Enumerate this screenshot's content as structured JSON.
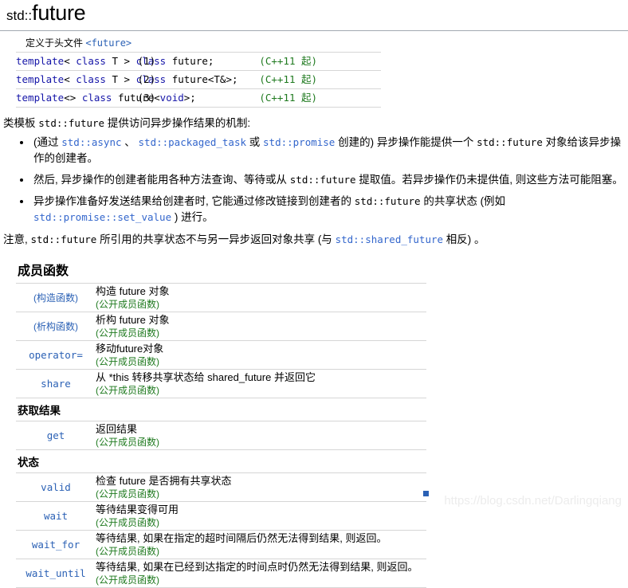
{
  "page": {
    "title_namespace": "std::",
    "title_name": "future"
  },
  "declaration_table": {
    "header_text": "定义于头文件 ",
    "header_code": "<future>",
    "rows": [
      {
        "code_parts": [
          {
            "t": "template",
            "c": "kw"
          },
          {
            "t": "< ",
            "c": "plain"
          },
          {
            "t": "class",
            "c": "kw"
          },
          {
            "t": " T > ",
            "c": "plain"
          },
          {
            "t": "class",
            "c": "kw"
          },
          {
            "t": " future;",
            "c": "plain"
          }
        ],
        "plain_code": "template< class T > class future;",
        "number": "(1)",
        "since": "(C++11 起)"
      },
      {
        "code_parts": [
          {
            "t": "template",
            "c": "kw"
          },
          {
            "t": "< ",
            "c": "plain"
          },
          {
            "t": "class",
            "c": "kw"
          },
          {
            "t": " T > ",
            "c": "plain"
          },
          {
            "t": "class",
            "c": "kw"
          },
          {
            "t": " future<T&>;",
            "c": "plain"
          }
        ],
        "plain_code": "template< class T > class future<T&>;",
        "number": "(2)",
        "since": "(C++11 起)"
      },
      {
        "code_parts": [
          {
            "t": "template",
            "c": "kw"
          },
          {
            "t": "<>",
            "c": "plain"
          },
          {
            "t": "            ",
            "c": "plain"
          },
          {
            "t": "class",
            "c": "kw"
          },
          {
            "t": " future<",
            "c": "plain"
          },
          {
            "t": "void",
            "c": "kw"
          },
          {
            "t": ">;",
            "c": "plain"
          }
        ],
        "plain_code": "template<>             class future<void>;",
        "number": "(3)",
        "since": "(C++11 起)"
      }
    ]
  },
  "description": {
    "intro_a": "类模板 ",
    "intro_code": "std::future",
    "intro_b": " 提供访问异步操作结果的机制:",
    "bullets": [
      {
        "p1": "(通过 ",
        "l1": "std::async",
        "p2": " 、 ",
        "l2": "std::packaged_task",
        "p3": " 或 ",
        "l3": "std::promise",
        "p4": " 创建的) 异步操作能提供一个 ",
        "c1": "std::future",
        "p5": " 对象给该异步操作的创建者。"
      },
      {
        "p1": "然后, 异步操作的创建者能用各种方法查询、等待或从 ",
        "c1": "std::future",
        "p5": " 提取值。若异步操作仍未提供值, 则这些方法可能阻塞。"
      },
      {
        "p1": "异步操作准备好发送结果给创建者时, 它能通过修改链接到创建者的 ",
        "c1": "std::future",
        "p5": " 的共享状态 (例如 ",
        "l1": "std::promise::set_value",
        "p6": " ) 进行。"
      }
    ],
    "note_a": "注意, ",
    "note_code": "std::future",
    "note_b": " 所引用的共享状态不与另一异步返回对象共享 (与 ",
    "note_link": "std::shared_future",
    "note_c": " 相反) 。"
  },
  "members": {
    "heading": "成员函数",
    "rows": [
      {
        "name": "(构造函数)",
        "name_is_cn": true,
        "desc": "构造 future 对象",
        "desc_code": "future",
        "kind": "(公开成员函数)"
      },
      {
        "name": "(析构函数)",
        "name_is_cn": true,
        "desc": "析构 future 对象",
        "desc_code": "future",
        "kind": "(公开成员函数)"
      },
      {
        "name": "operator=",
        "name_is_cn": false,
        "desc": "移动future对象",
        "kind": "(公开成员函数)"
      },
      {
        "name": "share",
        "name_is_cn": false,
        "desc": "从 *this 转移共享状态给 shared_future 并返回它",
        "kind": "(公开成员函数)"
      }
    ],
    "sections": [
      {
        "heading": "获取结果",
        "rows": [
          {
            "name": "get",
            "name_is_cn": false,
            "desc": "返回结果",
            "kind": "(公开成员函数)"
          }
        ]
      },
      {
        "heading": "状态",
        "rows": [
          {
            "name": "valid",
            "name_is_cn": false,
            "desc": "检查 future 是否拥有共享状态",
            "kind": "(公开成员函数)"
          },
          {
            "name": "wait",
            "name_is_cn": false,
            "desc": "等待结果变得可用",
            "kind": "(公开成员函数)"
          },
          {
            "name": "wait_for",
            "name_is_cn": false,
            "desc": "等待结果, 如果在指定的超时间隔后仍然无法得到结果, 则返回。",
            "kind": "(公开成员函数)"
          },
          {
            "name": "wait_until",
            "name_is_cn": false,
            "desc": "等待结果, 如果在已经到达指定的时间点时仍然无法得到结果, 则返回。",
            "kind": "(公开成员函数)"
          }
        ]
      }
    ]
  },
  "watermark": {
    "url": "https://blog.csdn.net/Darlingqiang"
  },
  "colors": {
    "keyword_blue": "#1515a8",
    "link_blue": "#3366cc",
    "member_blue": "#2b61b5",
    "green": "#1f7a1f",
    "rule_grey": "#d6d6d6"
  }
}
